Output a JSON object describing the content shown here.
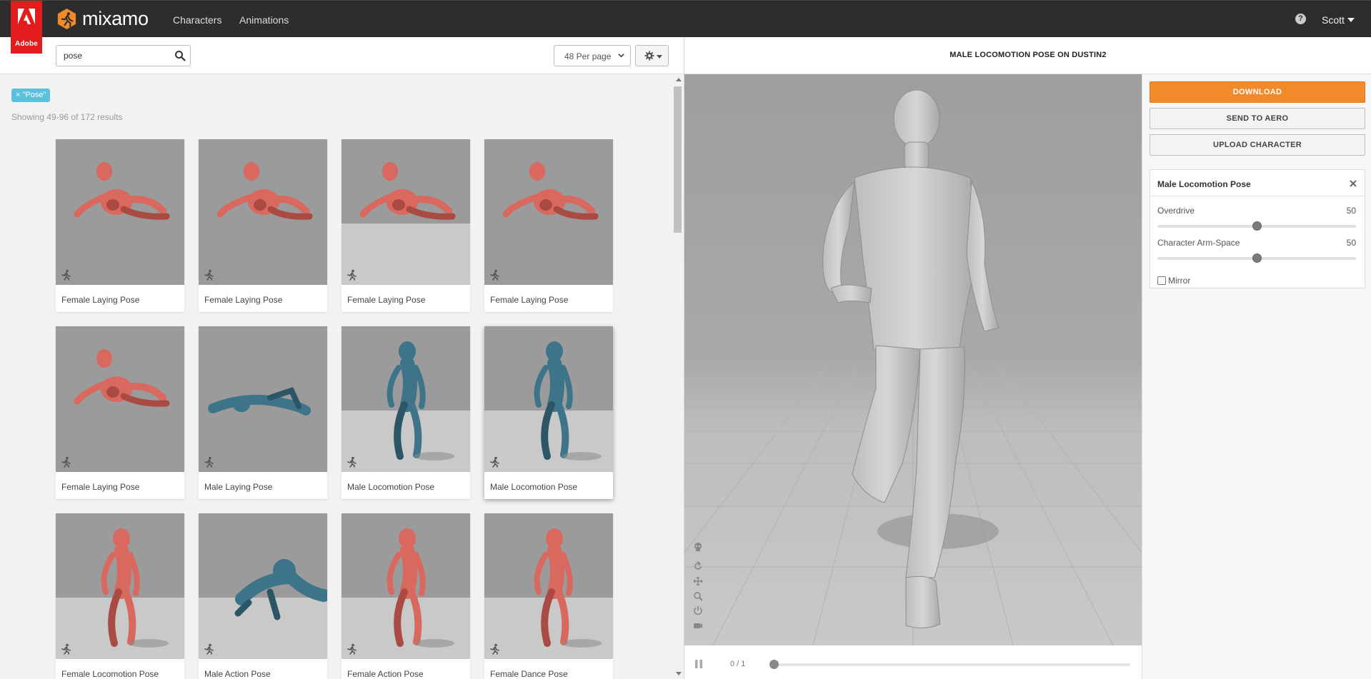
{
  "header": {
    "brand_badge": "Adobe",
    "logo_text": "mixamo",
    "nav": [
      "Characters",
      "Animations"
    ],
    "help_glyph": "?",
    "user_name": "Scott"
  },
  "toolbar": {
    "search_value": "pose",
    "per_page": "48 Per page",
    "settings_icon": "gear-icon"
  },
  "filter": {
    "tag": "× \"Pose\"",
    "showing": "Showing 49-96 of 172 results"
  },
  "cards": [
    {
      "label": "Female Laying Pose",
      "color": "#d9685f"
    },
    {
      "label": "Female Laying Pose",
      "color": "#d9685f"
    },
    {
      "label": "Female Laying Pose",
      "color": "#d9685f"
    },
    {
      "label": "Female Laying Pose",
      "color": "#d9685f"
    },
    {
      "label": "Female Laying Pose",
      "color": "#d9685f"
    },
    {
      "label": "Male Laying Pose",
      "color": "#3e7489"
    },
    {
      "label": "Male Locomotion Pose",
      "color": "#3e7489"
    },
    {
      "label": "Male Locomotion Pose",
      "color": "#3e7489",
      "selected": true
    },
    {
      "label": "Female Locomotion Pose",
      "color": "#d9685f"
    },
    {
      "label": "Male Action Pose",
      "color": "#3e7489"
    },
    {
      "label": "Female Action Pose",
      "color": "#d9685f"
    },
    {
      "label": "Female Dance Pose",
      "color": "#d9685f"
    }
  ],
  "viewer": {
    "title": "MALE LOCOMOTION POSE ON DUSTIN2",
    "frame": "0 / 1",
    "controls": [
      "skull-icon",
      "rotate-icon",
      "pan-icon",
      "zoom-icon",
      "power-icon",
      "camera-icon"
    ]
  },
  "side": {
    "download": "DOWNLOAD",
    "send_aero": "SEND TO AERO",
    "upload": "UPLOAD CHARACTER",
    "panel_title": "Male Locomotion Pose",
    "sliders": [
      {
        "label": "Overdrive",
        "value": "50",
        "fraction": 0.5
      },
      {
        "label": "Character Arm-Space",
        "value": "50",
        "fraction": 0.5
      }
    ],
    "mirror_label": "Mirror"
  },
  "colors": {
    "download_orange": "#f28a2a",
    "adobe_red": "#e21c1c",
    "tag_blue": "#5bc0de",
    "female_red": "#d9685f",
    "male_blue": "#3e7489"
  }
}
